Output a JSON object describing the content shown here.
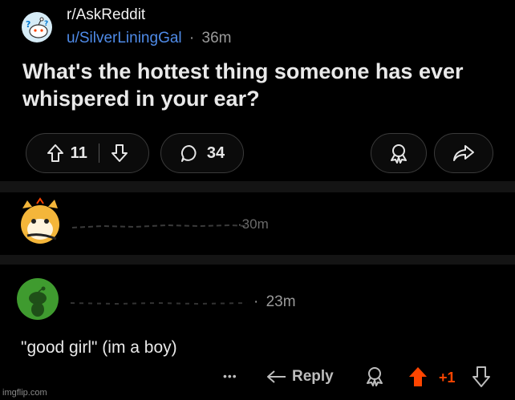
{
  "post": {
    "subreddit": "r/AskReddit",
    "author": "u/SilverLiningGal",
    "separator": "·",
    "age": "36m",
    "title_line1": "What's the hottest thing someone has ever",
    "title_line2": "whispered in your ear?",
    "upvotes": "11",
    "comments": "34"
  },
  "comment1": {
    "age_fragment": "·30m"
  },
  "comment2": {
    "separator": "·",
    "age": "23m",
    "text": "\"good girl\" (im a boy)",
    "more": "•••",
    "reply_label": "Reply",
    "vote_count": "+1"
  },
  "watermark": "imgflip.com",
  "colors": {
    "background": "#000000",
    "author_link": "#4f8be8",
    "upvote_active": "#ff4500",
    "divider": "#141414"
  }
}
